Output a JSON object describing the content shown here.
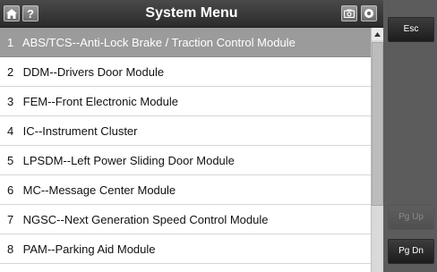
{
  "header": {
    "title": "System Menu",
    "help_label": "?"
  },
  "icons": {
    "home": "home-icon",
    "camera": "camera-icon",
    "record": "record-icon",
    "scroll_up": "arrow-up-icon"
  },
  "list": {
    "selected_index": 0,
    "items": [
      {
        "num": "1",
        "label": "ABS/TCS--Anti-Lock Brake / Traction Control Module"
      },
      {
        "num": "2",
        "label": "DDM--Drivers Door Module"
      },
      {
        "num": "3",
        "label": "FEM--Front Electronic Module"
      },
      {
        "num": "4",
        "label": "IC--Instrument Cluster"
      },
      {
        "num": "5",
        "label": "LPSDM--Left Power Sliding Door Module"
      },
      {
        "num": "6",
        "label": "MC--Message Center Module"
      },
      {
        "num": "7",
        "label": "NGSC--Next Generation Speed Control Module"
      },
      {
        "num": "8",
        "label": "PAM--Parking Aid Module"
      }
    ]
  },
  "side": {
    "esc_label": "Esc",
    "pgup_label": "Pg Up",
    "pgdn_label": "Pg Dn"
  },
  "colors": {
    "selected_row": "#9b9b9b",
    "title_bar": "#2b2b2b",
    "side_panel": "#5c5c5c"
  }
}
